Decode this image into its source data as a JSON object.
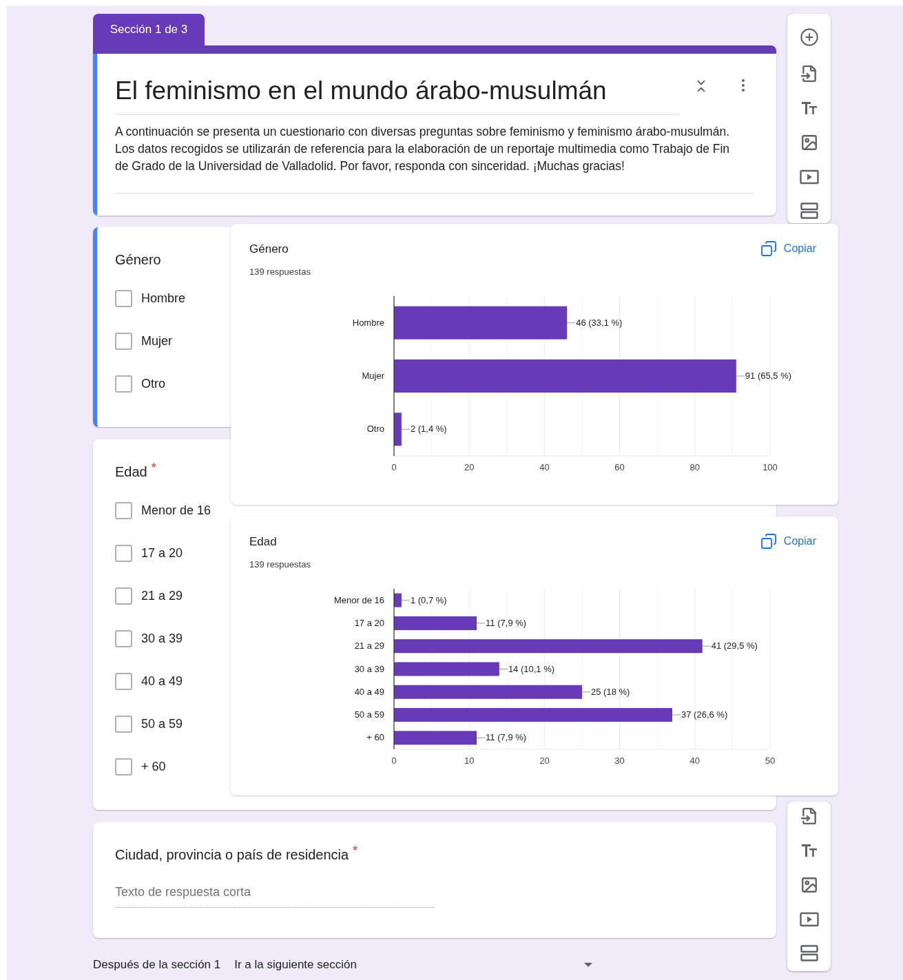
{
  "section_tab": {
    "label": "Sección 1 de 3"
  },
  "header": {
    "title": "El feminismo en el mundo árabo-musulmán",
    "description": "A continuación se presenta un cuestionario con diversas preguntas sobre feminismo y feminismo árabo-musulmán. Los datos recogidos se utilizarán de referencia para la elaboración de un reportaje multimedia como Trabajo de Fin de Grado de la Universidad de Valladolid. Por favor, responda con sinceridad. ¡Muchas gracias!",
    "selected": true
  },
  "questions": [
    {
      "kind": "checkboxes",
      "title": "Género",
      "selected": true,
      "options": [
        {
          "label": "Hombre",
          "checked": false
        },
        {
          "label": "Mujer",
          "checked": false
        },
        {
          "label": "Otro",
          "checked": false
        }
      ]
    },
    {
      "kind": "checkboxes",
      "title": "Edad",
      "required_mark": "*",
      "selected": false,
      "options": [
        {
          "label": "Menor de 16",
          "checked": false
        },
        {
          "label": "17 a 20",
          "checked": false
        },
        {
          "label": "21 a 29",
          "checked": false
        },
        {
          "label": "30 a 39",
          "checked": false
        },
        {
          "label": "40 a 49",
          "checked": false
        },
        {
          "label": "50 a 59",
          "checked": false
        },
        {
          "label": "+ 60",
          "checked": false
        }
      ]
    },
    {
      "kind": "short_answer",
      "title": "Ciudad, provincia o país de residencia",
      "required_mark": "*",
      "selected": false,
      "placeholder": "Texto de respuesta corta"
    }
  ],
  "summaries": [
    {
      "title": "Género",
      "count": "139 respuestas",
      "copy_button": "Copiar",
      "chart_data": {
        "type": "bar",
        "orientation": "horizontal",
        "categories": [
          "Hombre",
          "Mujer",
          "Otro"
        ],
        "values": [
          46,
          91,
          2
        ],
        "xlim": [
          0,
          100
        ],
        "grid": true,
        "xticks": [
          0,
          20,
          40,
          60,
          80,
          100
        ],
        "value_labels": [
          "46 (33,1 %)",
          "91 (65,5 %)",
          "2 (1,4 %)"
        ]
      }
    },
    {
      "title": "Edad",
      "count": "139 respuestas",
      "copy_button": "Copiar",
      "chart_data": {
        "type": "bar",
        "orientation": "horizontal",
        "categories": [
          "Menor de 16",
          "17 a 20",
          "21 a 29",
          "30 a 39",
          "40 a 49",
          "50 a 59",
          "+ 60"
        ],
        "values": [
          1,
          11,
          41,
          14,
          25,
          37,
          11
        ],
        "xlim": [
          0,
          50
        ],
        "grid": true,
        "xticks": [
          0,
          10,
          20,
          30,
          40,
          50
        ],
        "value_labels": [
          "1 (0,7 %)",
          "11 (7,9 %)",
          "41 (29,5 %)",
          "14 (10,1 %)",
          "25 (18 %)",
          "37 (26,6 %)",
          "11 (7,9 %)"
        ]
      }
    }
  ],
  "after_section": {
    "label": "Después de la sección 1",
    "value": "Ir a la siguiente sección"
  }
}
